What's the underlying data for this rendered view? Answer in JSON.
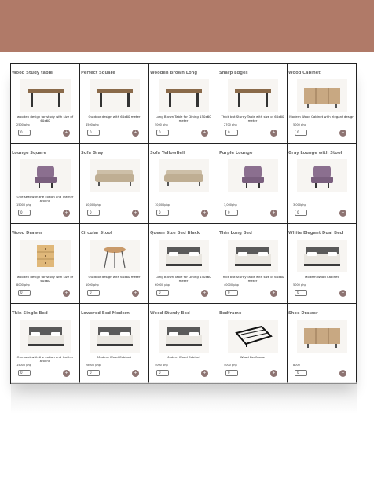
{
  "header": {
    "color": "#b07a68"
  },
  "products": [
    {
      "title": "Wood Study table",
      "desc": "wooden design for study with size of 60x60",
      "price": "2500 php",
      "qty": "0",
      "icon": "table-icon"
    },
    {
      "title": "Perfect Square",
      "desc": "Outdoor design with 60x60 meter",
      "price": "4500 php",
      "qty": "0",
      "icon": "table-icon"
    },
    {
      "title": "Wooden Brown Long",
      "desc": "Long Brown Table for Dining 150x60 meter",
      "price": "5000 php",
      "qty": "0",
      "icon": "table-icon"
    },
    {
      "title": "Sharp Edges",
      "desc": "Thick but Sturdy Table with size of 60x60 meter",
      "price": "2700 php",
      "qty": "0",
      "icon": "table-icon"
    },
    {
      "title": "Wood Cabinet",
      "desc": "Modern Wood Cabinet with elegant design",
      "price": "5000 php",
      "qty": "0",
      "icon": "cabinet-icon"
    },
    {
      "title": "Lounge Square",
      "desc": "One seat with the cotton and leather around",
      "price": "15000 php",
      "qty": "0",
      "icon": "chair-icon"
    },
    {
      "title": "Sofa Gray",
      "desc": "",
      "price": "10,000php",
      "qty": "0",
      "icon": "sofa-icon"
    },
    {
      "title": "Sofa YellowBell",
      "desc": "",
      "price": "10,000php",
      "qty": "0",
      "icon": "sofa-icon"
    },
    {
      "title": "Purple Lounge",
      "desc": "",
      "price": "3,000php",
      "qty": "0",
      "icon": "chair-icon"
    },
    {
      "title": "Gray Lounge with Stool",
      "desc": "",
      "price": "3,000php",
      "qty": "0",
      "icon": "chair-icon"
    },
    {
      "title": "Wood Drawer",
      "desc": "wooden design for study with size of 60x60",
      "price": "8000 php",
      "qty": "0",
      "icon": "drawer-icon"
    },
    {
      "title": "Circular Stool",
      "desc": "Outdoor design with 60x60 meter",
      "price": "1000 php",
      "qty": "0",
      "icon": "stool-icon"
    },
    {
      "title": "Queen Size Bed Black",
      "desc": "Long Brown Table for Dining 150x60 meter",
      "price": "60000 php",
      "qty": "0",
      "icon": "bed-icon"
    },
    {
      "title": "Thin Long Bed",
      "desc": "Thick but Sturdy Table with size of 60x60 meter",
      "price": "40000 php",
      "qty": "0",
      "icon": "bed-icon"
    },
    {
      "title": "White Elegant Dual Bed",
      "desc": "Modern Wood Cabinet",
      "price": "5000 php",
      "qty": "0",
      "icon": "bed-icon"
    },
    {
      "title": "Thin Single Bed",
      "desc": "One seat with the cotton and leather around",
      "price": "15000 php",
      "qty": "0",
      "icon": "bed-icon"
    },
    {
      "title": "Lowered Bed Modern",
      "desc": "Modern Wood Cabinet",
      "price": "78000 php",
      "qty": "0",
      "icon": "bed-icon"
    },
    {
      "title": "Wood Sturdy Bed",
      "desc": "Modern Wood Cabinet",
      "price": "5000 php",
      "qty": "0",
      "icon": "bed-icon"
    },
    {
      "title": "Bedframe",
      "desc": "Wood Bedframe",
      "price": "5000 php",
      "qty": "0",
      "icon": "bedframe-icon"
    },
    {
      "title": "Shoe Drawer",
      "desc": "",
      "price": "8000",
      "qty": "0",
      "icon": "cabinet-icon"
    }
  ]
}
